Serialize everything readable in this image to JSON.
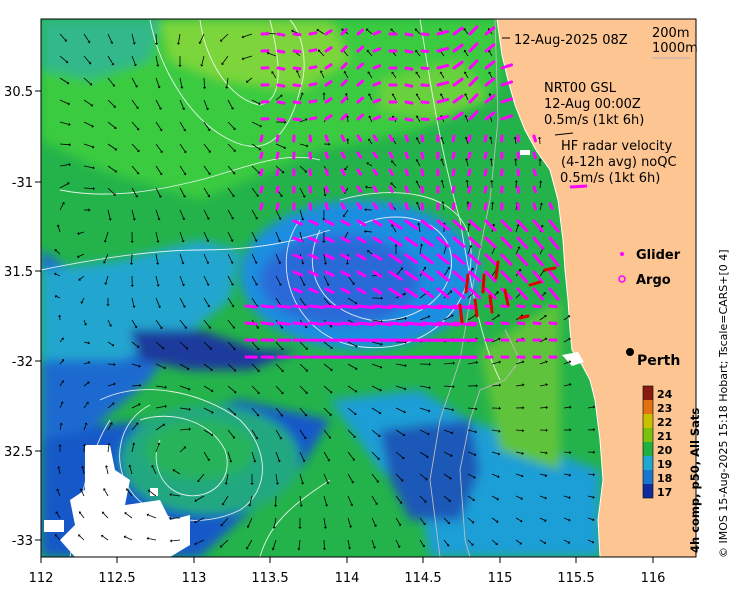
{
  "header": {
    "date_label": "12-Aug-2025 08Z",
    "depth_200": "200m",
    "depth_1000": "1000m"
  },
  "legend": {
    "nrt_line1": "NRT00 GSL",
    "nrt_line2": "12-Aug 00:00Z",
    "nrt_scale": "0.5m/s (1kt 6h)",
    "hf_line1": "HF radar velocity",
    "hf_line2": "(4-12h avg) noQC",
    "hf_scale": "0.5m/s (1kt 6h)",
    "glider_label": "Glider",
    "argo_label": "Argo",
    "city_label": "Perth"
  },
  "axes": {
    "x_ticks": [
      "112",
      "112.5",
      "113",
      "113.5",
      "114",
      "114.5",
      "115",
      "115.5",
      "116"
    ],
    "y_ticks": [
      "30.5",
      "-31",
      "31.5",
      "-32",
      "32.5",
      "-33"
    ]
  },
  "colorbar": {
    "title": "4h comp, p50, All Sats",
    "ticks": [
      "24",
      "23",
      "22",
      "21",
      "20",
      "19",
      "18",
      "17"
    ],
    "colors": [
      "#8a1a10",
      "#e07010",
      "#c8c000",
      "#7cc010",
      "#20b040",
      "#20a8d0",
      "#1878d0",
      "#102ba0"
    ]
  },
  "credit": "© IMOS 15-Aug-2025 15:18 Hobart; Tscale=CARS+[0 4]",
  "colors": {
    "land": "#fcc592",
    "hf_arrow": "#ff00ff",
    "hf_red": "#e00000"
  }
}
